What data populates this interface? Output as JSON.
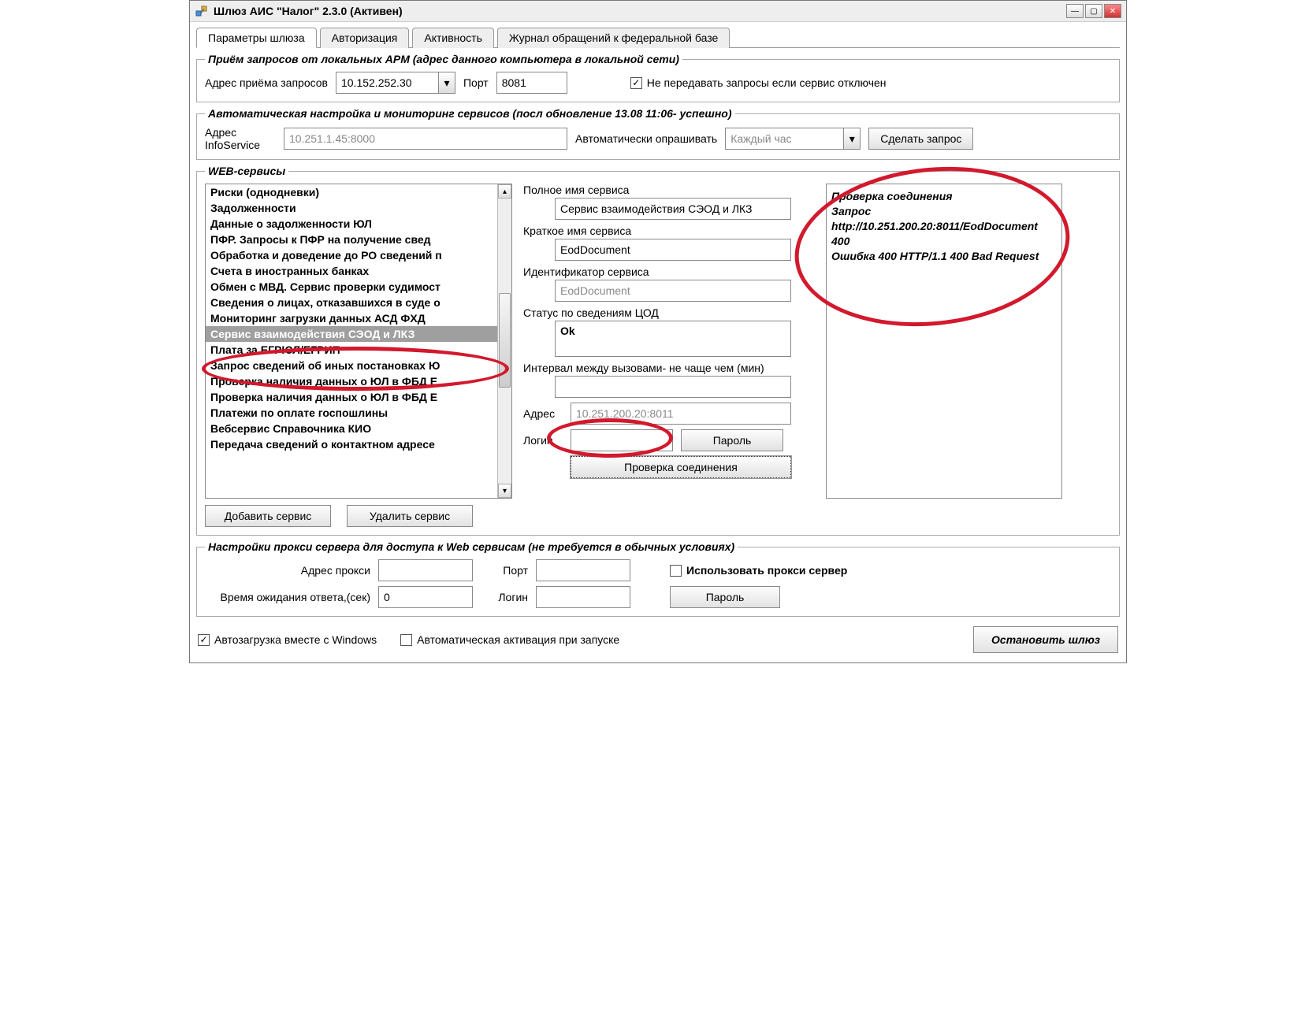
{
  "window": {
    "title": "Шлюз АИС \"Налог\" 2.3.0 (Активен)"
  },
  "tabs": {
    "items": [
      "Параметры шлюза",
      "Авторизация",
      "Активность",
      "Журнал обращений к федеральной базе"
    ],
    "active_index": 0
  },
  "group_receive": {
    "legend": "Приём запросов от локальных АРМ (адрес данного компьютера в локальной сети)",
    "addr_label": "Адрес приёма запросов",
    "addr_value": "10.152.252.30",
    "port_label": "Порт",
    "port_value": "8081",
    "no_forward_label": "Не передавать запросы если сервис отключен",
    "no_forward_checked": true
  },
  "group_auto": {
    "legend": "Автоматическая настройка и мониторинг сервисов (посл обновление  13.08 11:06- успешно)",
    "info_addr_label": "Адрес InfoService",
    "info_addr_value": "10.251.1.45:8000",
    "poll_label": "Автоматически опрашивать",
    "poll_value": "Каждый час",
    "request_btn": "Сделать запрос"
  },
  "group_web": {
    "legend": "WEB-сервисы",
    "list": [
      "Риски (однодневки)",
      "Задолженности",
      "Данные о задолженности ЮЛ",
      "ПФР. Запросы к ПФР на получение свед",
      "Обработка и доведение до РО сведений п",
      "Счета в иностранных банках",
      "Обмен с МВД. Сервис проверки судимост",
      "Сведения о лицах, отказавшихся в суде о",
      "Мониторинг загрузки данных АСД ФХД",
      "Сервис взаимодействия СЭОД и ЛКЗ",
      "Плата за ЕГРЮЛ/ЕГРИП",
      "Запрос сведений об иных постановках Ю",
      "Проверка наличия данных о ЮЛ в ФБД Е",
      "Проверка наличия данных о ЮЛ в ФБД Е",
      "Платежи по оплате госпошлины",
      "Вебсервис Справочника КИО",
      "Передача сведений о контактном адресе"
    ],
    "selected_index": 9,
    "add_btn": "Добавить сервис",
    "del_btn": "Удалить сервис",
    "full_name_label": "Полное имя сервиса",
    "full_name_value": "Сервис взаимодействия СЭОД и ЛКЗ",
    "short_name_label": "Краткое имя сервиса",
    "short_name_value": "EodDocument",
    "id_label": "Идентификатор сервиса",
    "id_value": "EodDocument",
    "status_label": "Статус по сведениям ЦОД",
    "status_value": "Ok",
    "interval_label": "Интервал между вызовами- не чаще чем (мин)",
    "interval_value": "",
    "addr_label": "Адрес",
    "addr_value": "10.251.200.20:8011",
    "login_label": "Логин",
    "login_value": "",
    "password_btn": "Пароль",
    "check_btn": "Проверка соединения",
    "log_text": "Проверка соединения\nЗапрос http://10.251.200.20:8011/EodDocument\n400\nОшибка 400 HTTP/1.1 400 Bad Request"
  },
  "group_proxy": {
    "legend": "Настройки прокси сервера для доступа к Web сервисам (не требуется в обычных условиях)",
    "addr_label": "Адрес прокси",
    "addr_value": "",
    "port_label": "Порт",
    "port_value": "",
    "use_proxy_label": "Использовать прокси сервер",
    "use_proxy_checked": false,
    "timeout_label": "Время ожидания ответа,(сек)",
    "timeout_value": "0",
    "login_label": "Логин",
    "login_value": "",
    "password_btn": "Пароль"
  },
  "footer": {
    "autostart_label": "Автозагрузка вместе с Windows",
    "autostart_checked": true,
    "autoactivate_label": "Автоматическая активация при запуске",
    "autoactivate_checked": false,
    "stop_btn": "Остановить шлюз"
  }
}
